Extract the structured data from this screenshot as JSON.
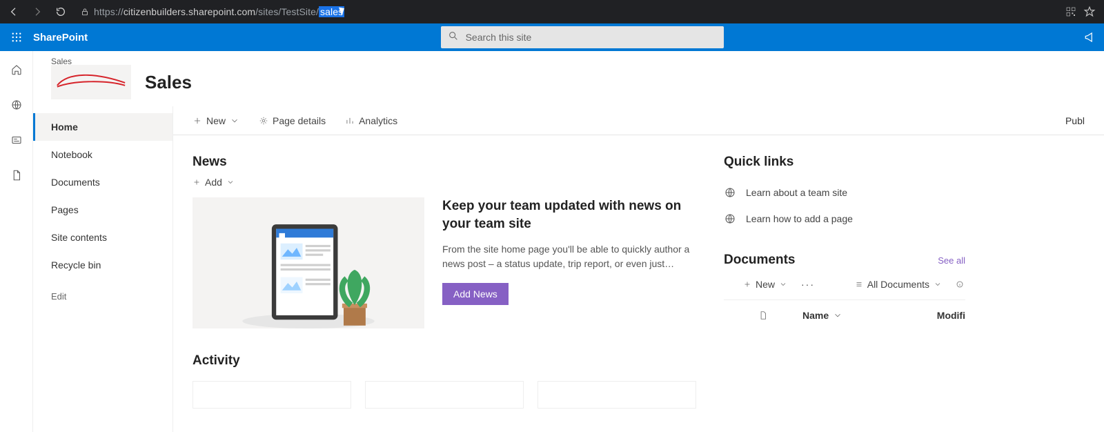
{
  "browser": {
    "url_proto": "https://",
    "url_host": "citizenbuilders.sharepoint.com",
    "url_path": "/sites/TestSite/",
    "url_selected": "sales"
  },
  "suite": {
    "brand": "SharePoint",
    "search_placeholder": "Search this site"
  },
  "site": {
    "breadcrumb": "Sales",
    "title": "Sales"
  },
  "leftnav": {
    "items": [
      "Home",
      "Notebook",
      "Documents",
      "Pages",
      "Site contents",
      "Recycle bin"
    ],
    "edit": "Edit"
  },
  "cmdbar": {
    "new": "New",
    "page_details": "Page details",
    "analytics": "Analytics",
    "publish_prefix": "Publ"
  },
  "news": {
    "heading": "News",
    "add": "Add",
    "headline": "Keep your team updated with news on your team site",
    "body": "From the site home page you'll be able to quickly author a news post – a status update, trip report, or even just…",
    "button": "Add News"
  },
  "activity": {
    "heading": "Activity"
  },
  "quicklinks": {
    "heading": "Quick links",
    "items": [
      "Learn about a team site",
      "Learn how to add a page"
    ]
  },
  "documents": {
    "heading": "Documents",
    "see_all": "See all",
    "new": "New",
    "view": "All Documents",
    "col_name": "Name",
    "col_modified": "Modifi"
  }
}
